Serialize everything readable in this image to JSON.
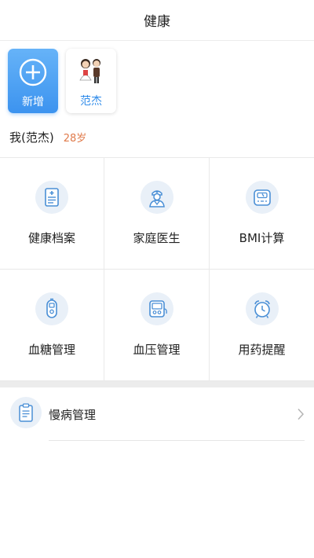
{
  "header": {
    "title": "健康"
  },
  "members": {
    "add_label": "新增",
    "person_label": "范杰"
  },
  "profile": {
    "name": "我(范杰)",
    "age": "28岁"
  },
  "grid": [
    {
      "label": "健康档案",
      "icon": "health-record-icon"
    },
    {
      "label": "家庭医生",
      "icon": "doctor-icon"
    },
    {
      "label": "BMI计算",
      "icon": "scale-icon"
    },
    {
      "label": "血糖管理",
      "icon": "glucose-meter-icon"
    },
    {
      "label": "血压管理",
      "icon": "blood-pressure-icon"
    },
    {
      "label": "用药提醒",
      "icon": "alarm-clock-icon"
    }
  ],
  "list": [
    {
      "label": "慢病管理",
      "icon": "clipboard-icon"
    }
  ],
  "colors": {
    "accent": "#3c93ef",
    "icon_blue": "#4a8fd6",
    "icon_bg": "#e9f0f8",
    "age": "#e07a4a"
  }
}
